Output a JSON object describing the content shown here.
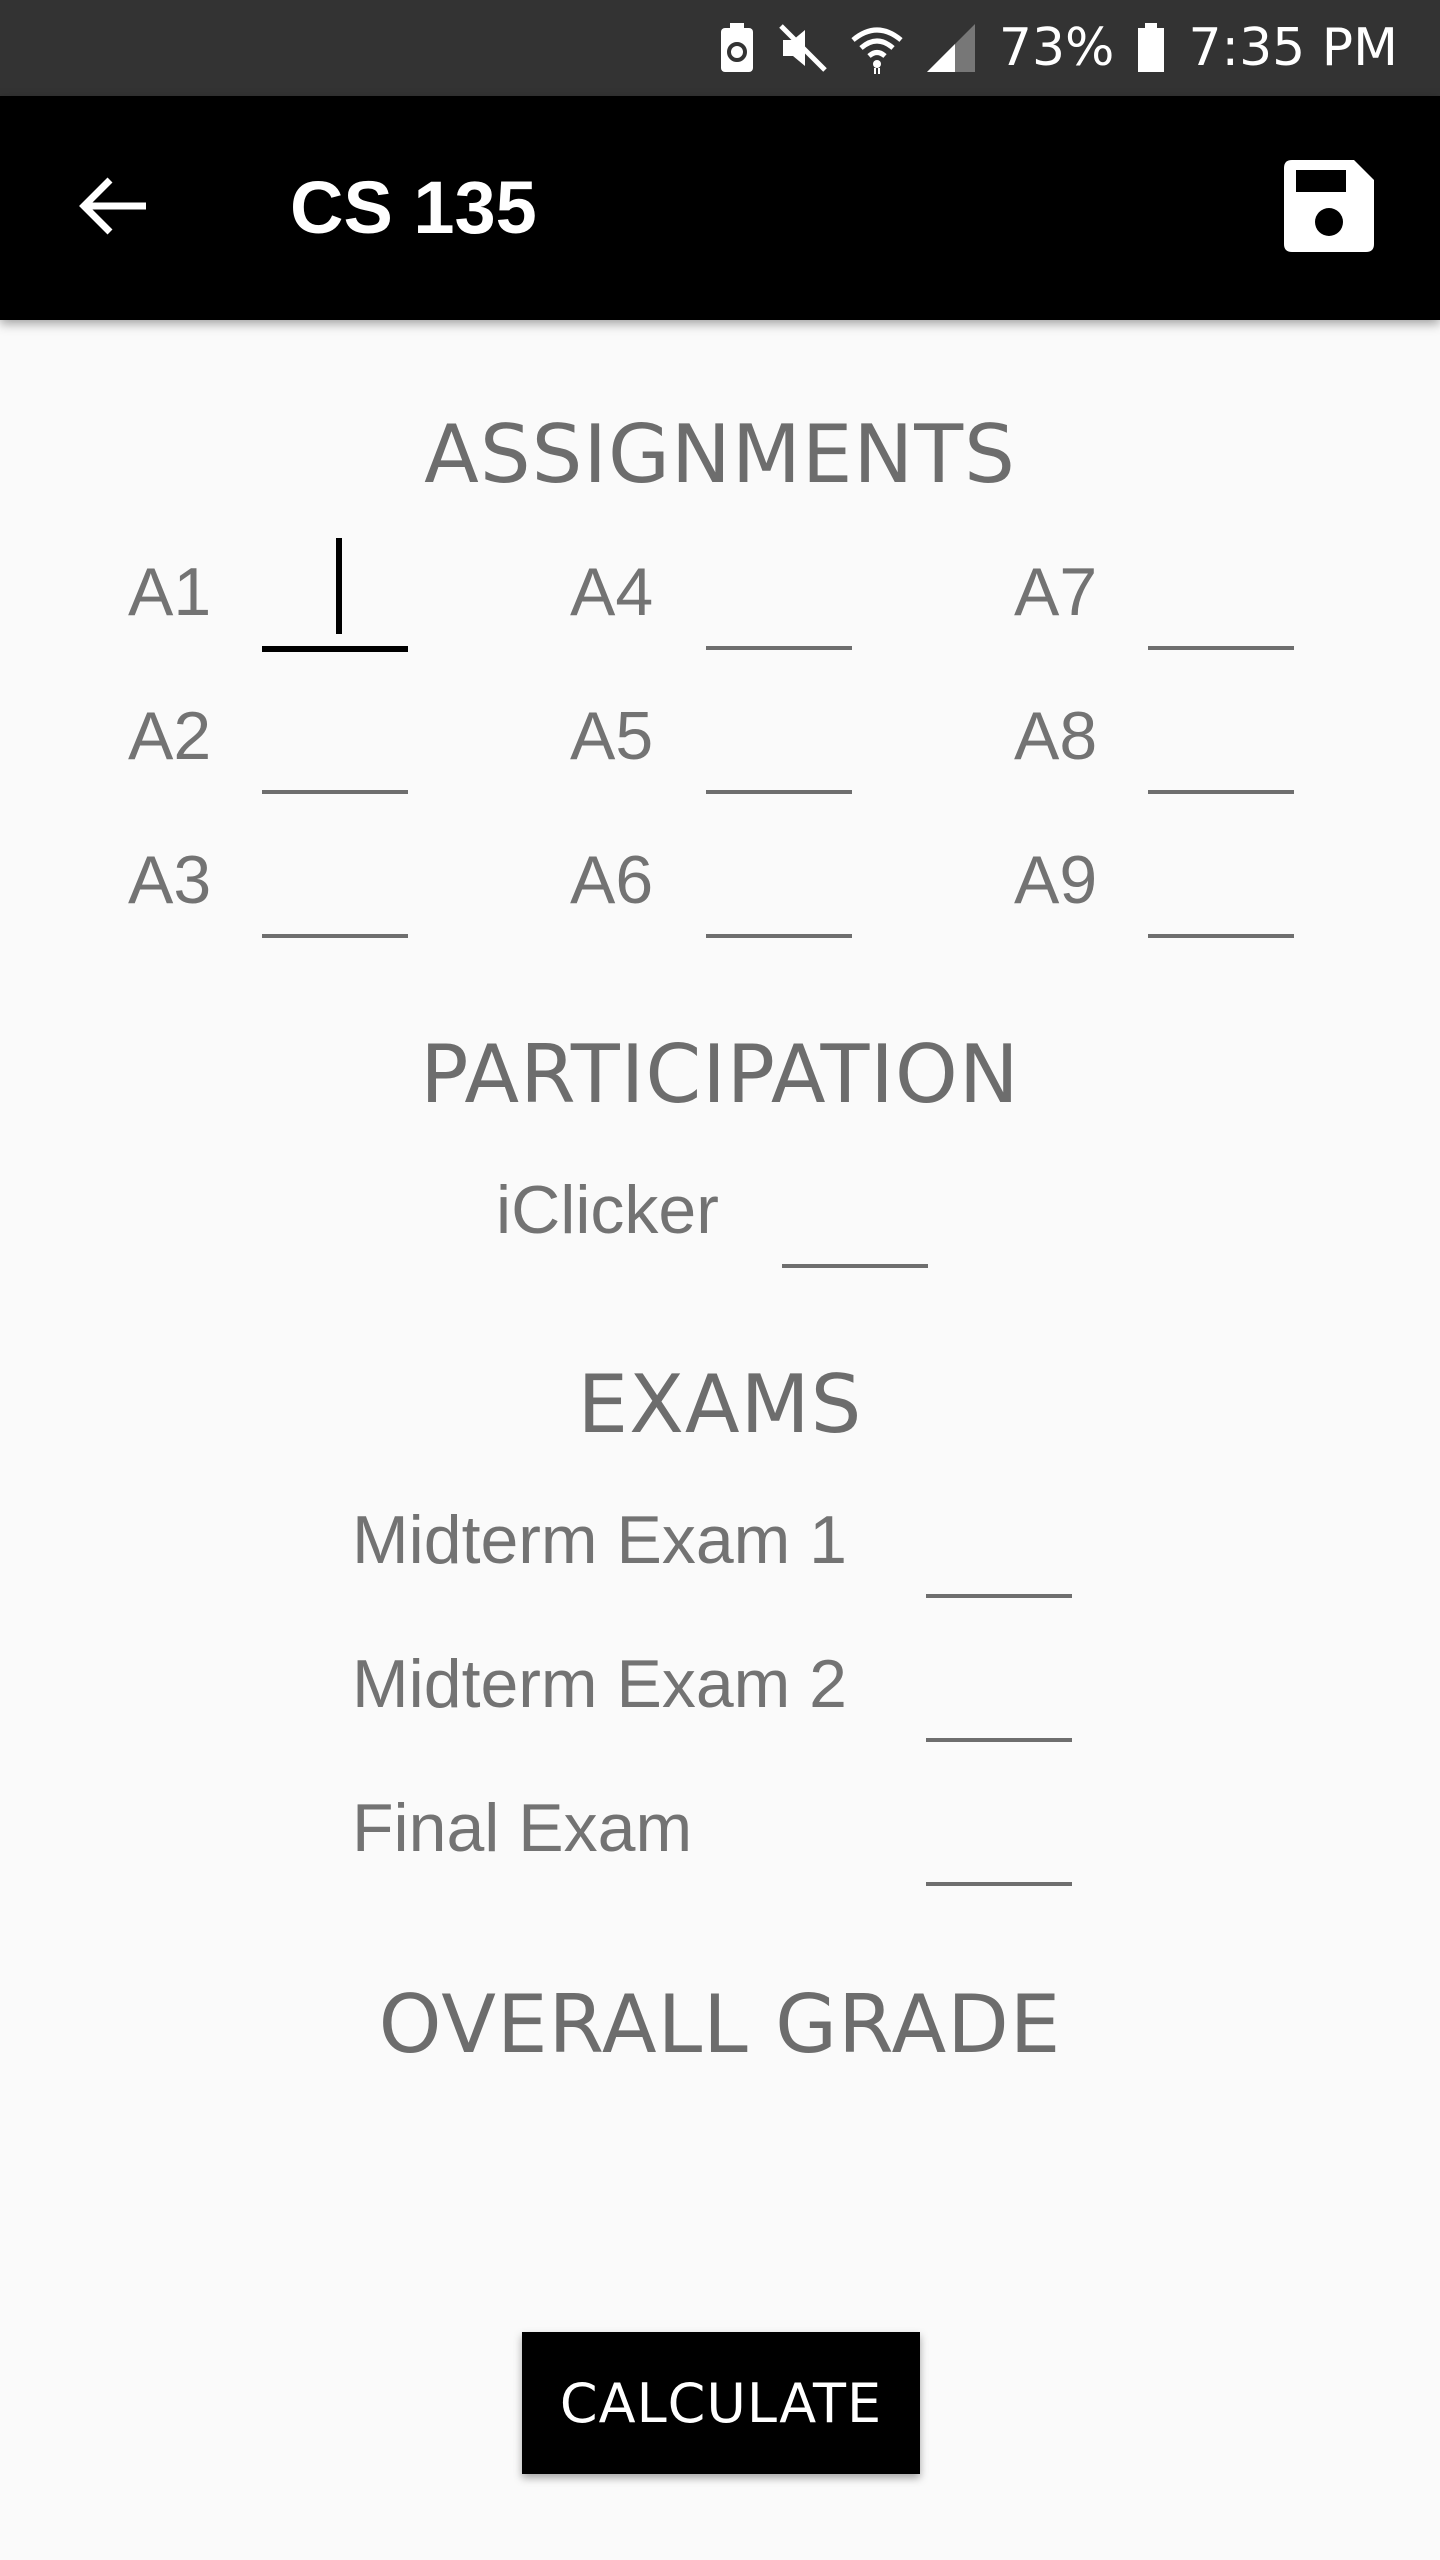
{
  "status_bar": {
    "battery_percent": "73%",
    "time": "7:35 PM",
    "icons": [
      "battery-saver-icon",
      "mute-icon",
      "wifi-icon",
      "signal-icon",
      "battery-icon"
    ]
  },
  "app_bar": {
    "title": "CS 135",
    "back_icon": "arrow-back-icon",
    "save_icon": "save-icon"
  },
  "assignments": {
    "heading": "ASSIGNMENTS",
    "items": [
      {
        "label": "A1",
        "value": ""
      },
      {
        "label": "A2",
        "value": ""
      },
      {
        "label": "A3",
        "value": ""
      },
      {
        "label": "A4",
        "value": ""
      },
      {
        "label": "A5",
        "value": ""
      },
      {
        "label": "A6",
        "value": ""
      },
      {
        "label": "A7",
        "value": ""
      },
      {
        "label": "A8",
        "value": ""
      },
      {
        "label": "A9",
        "value": ""
      }
    ]
  },
  "participation": {
    "heading": "PARTICIPATION",
    "items": [
      {
        "label": "iClicker",
        "value": ""
      }
    ]
  },
  "exams": {
    "heading": "EXAMS",
    "items": [
      {
        "label": "Midterm Exam 1",
        "value": ""
      },
      {
        "label": "Midterm Exam 2",
        "value": ""
      },
      {
        "label": "Final Exam",
        "value": ""
      }
    ]
  },
  "overall": {
    "heading": "OVERALL GRADE",
    "value": ""
  },
  "calculate_button": {
    "label": "CALCULATE"
  },
  "colors": {
    "status_bar": "#333333",
    "app_bar": "#000000",
    "background": "#fafafa",
    "text_gray": "#737373",
    "button": "#000000"
  }
}
